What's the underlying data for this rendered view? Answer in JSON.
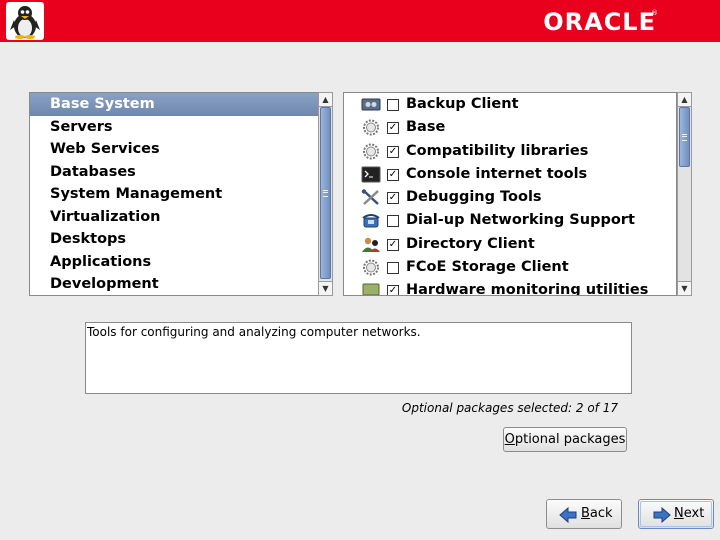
{
  "header": {
    "brand": "ORACLE",
    "brand_mark": "®",
    "logo_icon": "tux-penguin-icon",
    "color": "#e8001c"
  },
  "categories": [
    {
      "label": "Base System",
      "selected": true
    },
    {
      "label": "Servers"
    },
    {
      "label": "Web Services"
    },
    {
      "label": "Databases"
    },
    {
      "label": "System Management"
    },
    {
      "label": "Virtualization"
    },
    {
      "label": "Desktops"
    },
    {
      "label": "Applications"
    },
    {
      "label": "Development"
    }
  ],
  "groups": [
    {
      "label": "Backup Client",
      "checked": false,
      "icon": "tape-drive-icon"
    },
    {
      "label": "Base",
      "checked": true,
      "icon": "gear-icon"
    },
    {
      "label": "Compatibility libraries",
      "checked": true,
      "icon": "gear-icon"
    },
    {
      "label": "Console internet tools",
      "checked": true,
      "icon": "terminal-icon"
    },
    {
      "label": "Debugging Tools",
      "checked": true,
      "icon": "tools-icon"
    },
    {
      "label": "Dial-up Networking Support",
      "checked": false,
      "icon": "phone-icon"
    },
    {
      "label": "Directory Client",
      "checked": true,
      "icon": "users-icon"
    },
    {
      "label": "FCoE Storage Client",
      "checked": false,
      "icon": "gear-icon"
    },
    {
      "label": "Hardware monitoring utilities",
      "checked": true,
      "icon": "monitor-icon"
    }
  ],
  "description": "Tools for configuring and analyzing computer networks.",
  "optional_count": "Optional packages selected: 2 of 17",
  "buttons": {
    "optional_packages": "ptional packages",
    "optional_packages_mnemonic": "O",
    "back": "ack",
    "back_mnemonic": "B",
    "next": "ext",
    "next_mnemonic": "N"
  }
}
